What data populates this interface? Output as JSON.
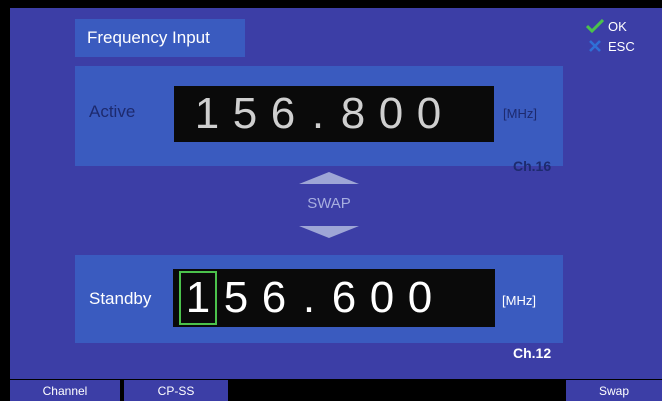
{
  "title": "Frequency Input",
  "softkeys_top_right": {
    "ok": {
      "label": "OK",
      "icon": "check-icon",
      "color": "#4bc24b"
    },
    "esc": {
      "label": "ESC",
      "icon": "x-icon",
      "color": "#2f6fd6"
    }
  },
  "active": {
    "label": "Active",
    "digits": [
      "1",
      "5",
      "6",
      ".",
      "8",
      "0",
      "0"
    ],
    "unit": "[MHz]",
    "channel": "Ch.16"
  },
  "swap": {
    "label": "SWAP"
  },
  "standby": {
    "label": "Standby",
    "digits": [
      "1",
      "5",
      "6",
      ".",
      "6",
      "0",
      "0"
    ],
    "cursor_index": 0,
    "unit": "[MHz]",
    "channel": "Ch.12"
  },
  "softkeys_bottom": {
    "channel": "Channel",
    "cpss": "CP-SS",
    "swap": "Swap"
  },
  "colors": {
    "background": "#3c3ea6",
    "panel": "#3a5bbf",
    "cursor": "#4bc24b"
  }
}
